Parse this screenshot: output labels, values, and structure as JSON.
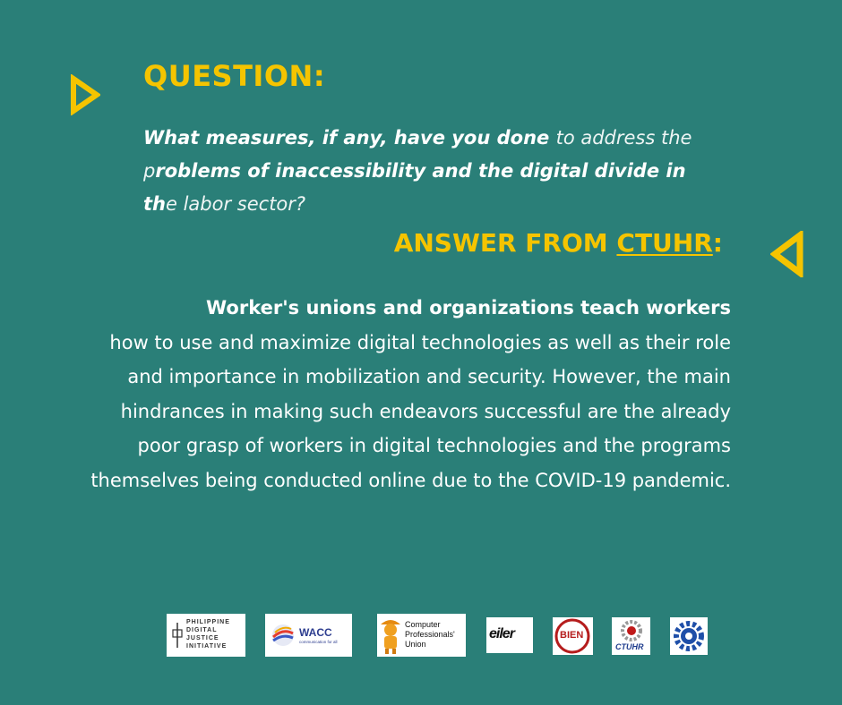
{
  "question": {
    "heading": "QUESTION:",
    "text_parts": [
      {
        "t": "What measures, if any, have you done ",
        "style": "bold"
      },
      {
        "t": "to address the ",
        "style": "light"
      },
      {
        "t": "p",
        "style": "light"
      },
      {
        "t": "roblems of inaccessibility and the digital divide in ",
        "style": "bold"
      },
      {
        "t": "th",
        "style": "bold"
      },
      {
        "t": "e labor sector?",
        "style": "light"
      }
    ]
  },
  "answer": {
    "heading_prefix": "ANSWER FROM ",
    "heading_org": "CTUHR",
    "heading_suffix": ":",
    "lead": "Worker's unions and organizations teach workers",
    "body": "how to use and maximize digital technologies as well as their role and importance in mobilization and security. However, the main hindrances in making such endeavors successful are the already poor grasp of workers in digital technologies and the programs themselves being conducted online due to the COVID-19 pandemic."
  },
  "logos": {
    "pdji": {
      "line1": "PHILIPPINE",
      "line2": "DIGITAL",
      "line3": "JUSTICE",
      "line4": "INITIATIVE"
    },
    "wacc": {
      "name": "WACC",
      "tagline": "communication for all"
    },
    "cpu": {
      "line1": "Computer",
      "line2": "Professionals'",
      "line3": "Union"
    },
    "eiler": {
      "name": "eiler"
    },
    "bien": {
      "name": "BIEN"
    },
    "ctuhr": {
      "name": "CTUHR"
    },
    "gear": {
      "name": "gear-logo"
    }
  },
  "colors": {
    "background": "#2a7f78",
    "accent": "#f5c400",
    "text": "#ffffff"
  }
}
